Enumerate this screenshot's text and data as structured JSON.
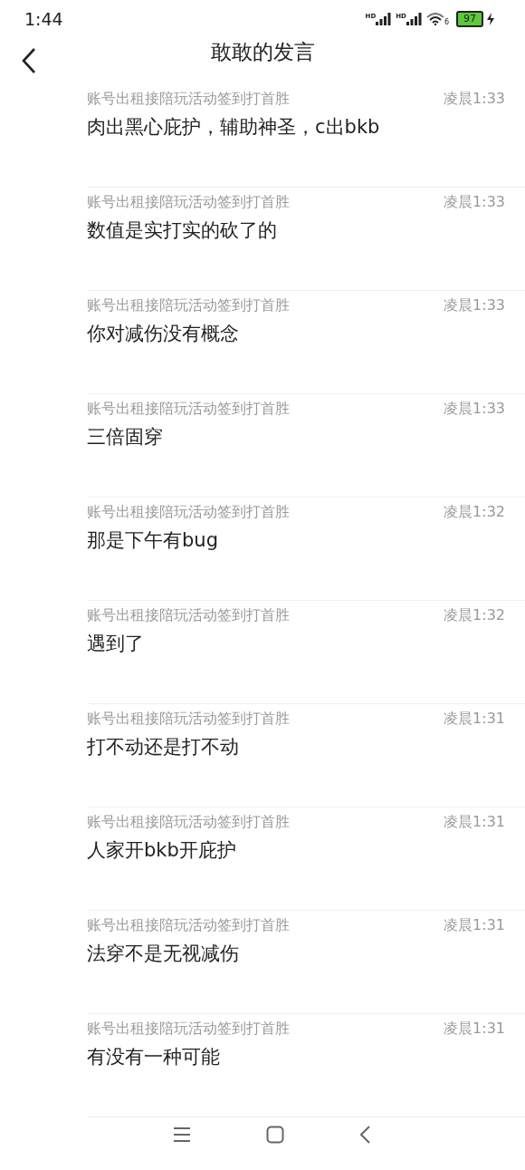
{
  "status_bar": {
    "time": "1:44",
    "network_labels": [
      "HD",
      "HD"
    ],
    "wifi_label": "6",
    "battery": "97"
  },
  "header": {
    "title": "敢敢的发言"
  },
  "messages": [
    {
      "group": "账号出租接陪玩活动签到打首胜",
      "time": "凌晨1:33",
      "text": "肉出黑心庇护，辅助神圣，c出bkb"
    },
    {
      "group": "账号出租接陪玩活动签到打首胜",
      "time": "凌晨1:33",
      "text": "数值是实打实的砍了的"
    },
    {
      "group": "账号出租接陪玩活动签到打首胜",
      "time": "凌晨1:33",
      "text": "你对减伤没有概念"
    },
    {
      "group": "账号出租接陪玩活动签到打首胜",
      "time": "凌晨1:33",
      "text": "三倍固穿"
    },
    {
      "group": "账号出租接陪玩活动签到打首胜",
      "time": "凌晨1:32",
      "text": "那是下午有bug"
    },
    {
      "group": "账号出租接陪玩活动签到打首胜",
      "time": "凌晨1:32",
      "text": "遇到了"
    },
    {
      "group": "账号出租接陪玩活动签到打首胜",
      "time": "凌晨1:31",
      "text": "打不动还是打不动"
    },
    {
      "group": "账号出租接陪玩活动签到打首胜",
      "time": "凌晨1:31",
      "text": "人家开bkb开庇护"
    },
    {
      "group": "账号出租接陪玩活动签到打首胜",
      "time": "凌晨1:31",
      "text": "法穿不是无视减伤"
    },
    {
      "group": "账号出租接陪玩活动签到打首胜",
      "time": "凌晨1:31",
      "text": "有没有一种可能"
    }
  ]
}
